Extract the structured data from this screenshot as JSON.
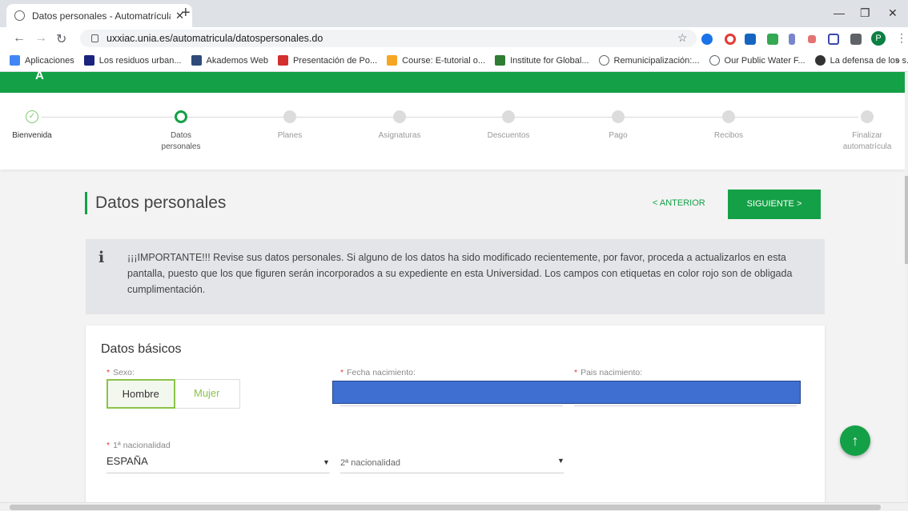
{
  "browser": {
    "tab_title": "Datos personales - Automatrícula",
    "url": "uxxiac.unia.es/automatricula/datospersonales.do",
    "profile_initial": "P",
    "bookmarks": [
      {
        "label": "Aplicaciones",
        "color": "#4285f4"
      },
      {
        "label": "Los residuos urban...",
        "color": "#1a237e"
      },
      {
        "label": "Akademos Web",
        "color": "#2e4a7a"
      },
      {
        "label": "Presentación de Po...",
        "color": "#d32f2f"
      },
      {
        "label": "Course: E-tutorial o...",
        "color": "#f5a623"
      },
      {
        "label": "Institute for Global...",
        "color": "#2e7d32"
      },
      {
        "label": "Remunicipalización:...",
        "color": "#5f6368"
      },
      {
        "label": "Our Public Water F...",
        "color": "#5f6368"
      },
      {
        "label": "La defensa de los s...",
        "color": "#333333"
      }
    ],
    "bookmarks_more": "»"
  },
  "header": {
    "brand": "A"
  },
  "steps": [
    {
      "label": "Bienvenida",
      "state": "done"
    },
    {
      "label": "Datos personales",
      "state": "current"
    },
    {
      "label": "Planes",
      "state": "todo"
    },
    {
      "label": "Asignaturas",
      "state": "todo"
    },
    {
      "label": "Descuentos",
      "state": "todo"
    },
    {
      "label": "Pago",
      "state": "todo"
    },
    {
      "label": "Recibos",
      "state": "todo"
    },
    {
      "label": "Finalizar automatrícula",
      "state": "todo"
    }
  ],
  "page": {
    "title": "Datos personales",
    "prev_label": "< ANTERIOR",
    "next_label": "SIGUIENTE >",
    "notice": "¡¡¡IMPORTANTE!!! Revise sus datos personales. Si alguno de los datos ha sido modificado recientemente, por favor, proceda a actualizarlos en esta pantalla, puesto que los que figuren serán incorporados a su expediente en esta Universidad. Los campos con etiquetas en color rojo son de obligada cumplimentación."
  },
  "form": {
    "section_title": "Datos básicos",
    "sexo_label": "Sexo:",
    "sexo_options": [
      "Hombre",
      "Mujer"
    ],
    "fecha_label": "Fecha nacimiento:",
    "pais_label": "Pais nacimiento:",
    "nac1_label": "1ª nacionalidad",
    "nac1_value": "ESPAÑA",
    "nac2_placeholder": "2ª nacionalidad",
    "required_mark": "*"
  },
  "colors": {
    "accent": "#14a046",
    "required": "#e53935"
  }
}
